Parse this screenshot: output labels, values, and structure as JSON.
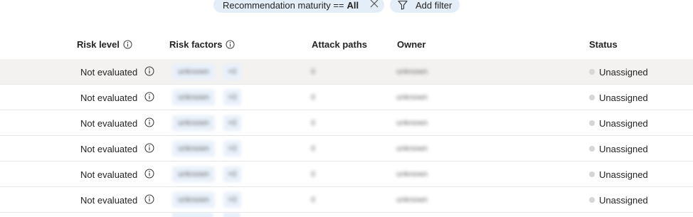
{
  "filters": {
    "maturity_label": "Recommendation maturity ==",
    "maturity_value": "All",
    "add_filter_label": "Add filter"
  },
  "table": {
    "columns": {
      "risk_level": "Risk level",
      "risk_factors": "Risk factors",
      "attack_paths": "Attack paths",
      "owner": "Owner",
      "status": "Status"
    },
    "rows": [
      {
        "risk_level": "Not evaluated",
        "risk_factor": "unknown",
        "risk_factor_count": "+0",
        "attack_paths": "0",
        "owner": "unknown",
        "status": "Unassigned"
      },
      {
        "risk_level": "Not evaluated",
        "risk_factor": "unknown",
        "risk_factor_count": "+0",
        "attack_paths": "0",
        "owner": "unknown",
        "status": "Unassigned"
      },
      {
        "risk_level": "Not evaluated",
        "risk_factor": "unknown",
        "risk_factor_count": "+0",
        "attack_paths": "0",
        "owner": "unknown",
        "status": "Unassigned"
      },
      {
        "risk_level": "Not evaluated",
        "risk_factor": "unknown",
        "risk_factor_count": "+0",
        "attack_paths": "0",
        "owner": "unknown",
        "status": "Unassigned"
      },
      {
        "risk_level": "Not evaluated",
        "risk_factor": "unknown",
        "risk_factor_count": "+0",
        "attack_paths": "0",
        "owner": "unknown",
        "status": "Unassigned"
      },
      {
        "risk_level": "Not evaluated",
        "risk_factor": "unknown",
        "risk_factor_count": "+0",
        "attack_paths": "0",
        "owner": "unknown",
        "status": "Unassigned"
      }
    ]
  },
  "colors": {
    "pill_bg": "#e3eef8",
    "row_selected_bg": "#f3f2f1",
    "status_dot": "#d6d6d6"
  },
  "icons": {
    "close": "close-icon",
    "filter": "funnel-icon",
    "info": "info-icon"
  }
}
